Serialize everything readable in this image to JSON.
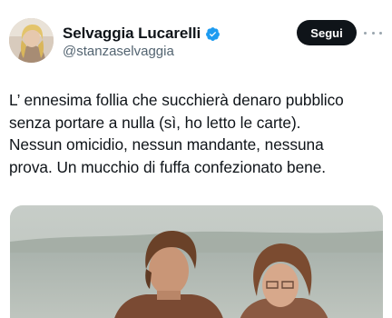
{
  "author": {
    "display_name": "Selvaggia Lucarelli",
    "handle": "@stanzaselvaggia",
    "verified": true,
    "avatar_icon": "profile-photo-avatar"
  },
  "actions": {
    "follow_label": "Segui",
    "more_icon": "more-options-icon"
  },
  "tweet": {
    "text": "L’ ennesima follia che succhierà denaro pubblico\nsenza portare a nulla (sì, ho letto le carte).\nNessun omicidio, nessun mandante, nessuna\nprova. Un mucchio di fuffa confezionato bene."
  },
  "media": {
    "kind": "photo",
    "icon": "vintage-photo-two-people"
  },
  "colors": {
    "text": "#0f1419",
    "secondary_text": "#536471",
    "verified_blue": "#1d9bf0",
    "follow_bg": "#0f1419",
    "follow_text": "#ffffff"
  }
}
